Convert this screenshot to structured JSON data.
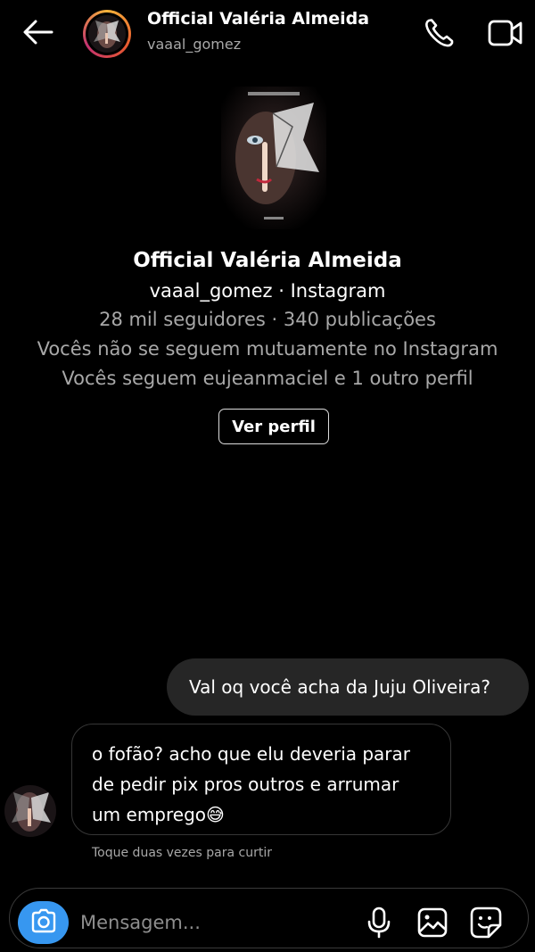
{
  "header": {
    "name": "Official Valéria Almeida",
    "username": "vaaal_gomez",
    "icons": [
      "back-arrow-icon",
      "phone-icon",
      "video-camera-icon"
    ]
  },
  "profile": {
    "name": "Official Valéria Almeida",
    "subtitle": "vaaal_gomez · Instagram",
    "stats": "28 mil seguidores · 340 publicações",
    "mutual": "Vocês não se seguem mutuamente no Instagram",
    "follows": "Vocês seguem eujeanmaciel e 1 outro perfil",
    "button_label": "Ver perfil"
  },
  "messages": [
    {
      "direction": "outgoing",
      "text": "Val oq você acha da Juju Oliveira?"
    },
    {
      "direction": "incoming",
      "text": "o fofão? acho que elu deveria parar de pedir pix pros outros e arrumar um emprego😅"
    }
  ],
  "hint": "Toque duas vezes para curtir",
  "composer": {
    "placeholder": "Mensagem...",
    "icons": [
      "camera-icon",
      "microphone-icon",
      "gallery-icon",
      "sticker-icon"
    ],
    "camera_color": "#3797f0"
  }
}
